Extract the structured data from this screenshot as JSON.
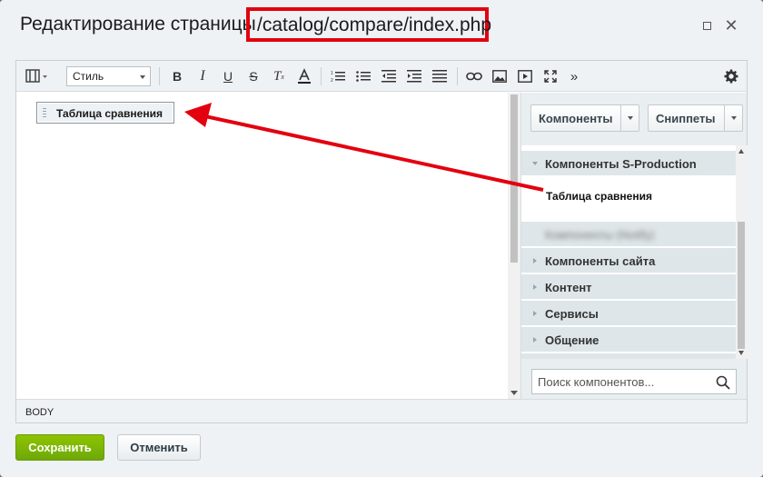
{
  "window": {
    "title": "Редактирование страницы",
    "path": "/catalog/compare/index.php",
    "maximize_icon": "maximize-icon",
    "close_icon": "close-icon"
  },
  "toolbar": {
    "style_select": "Стиль",
    "buttons": [
      "template-icon",
      "bold-icon",
      "italic-icon",
      "underline-icon",
      "strikethrough-icon",
      "clear-format-icon",
      "text-color-icon",
      "ordered-list-icon",
      "unordered-list-icon",
      "outdent-icon",
      "indent-icon",
      "align-icon",
      "link-icon",
      "image-icon",
      "video-icon",
      "fullscreen-icon",
      "more-icon",
      "settings-icon"
    ]
  },
  "content": {
    "component_chip": "Таблица сравнения"
  },
  "sidebar": {
    "components_button": "Компоненты",
    "snippets_button": "Сниппеты",
    "groups": [
      {
        "label": "Компоненты S-Production",
        "expanded": true
      },
      {
        "label": "Компоненты (Notify)",
        "blurred": true
      },
      {
        "label": "Компоненты сайта"
      },
      {
        "label": "Контент"
      },
      {
        "label": "Сервисы"
      },
      {
        "label": "Общение"
      }
    ],
    "selected_item": "Таблица сравнения",
    "search_placeholder": "Поиск компонентов..."
  },
  "statusbar": {
    "path": "BODY"
  },
  "footer": {
    "save": "Сохранить",
    "cancel": "Отменить"
  },
  "colors": {
    "highlight": "#e3000f",
    "save_green": "#7ab800"
  }
}
